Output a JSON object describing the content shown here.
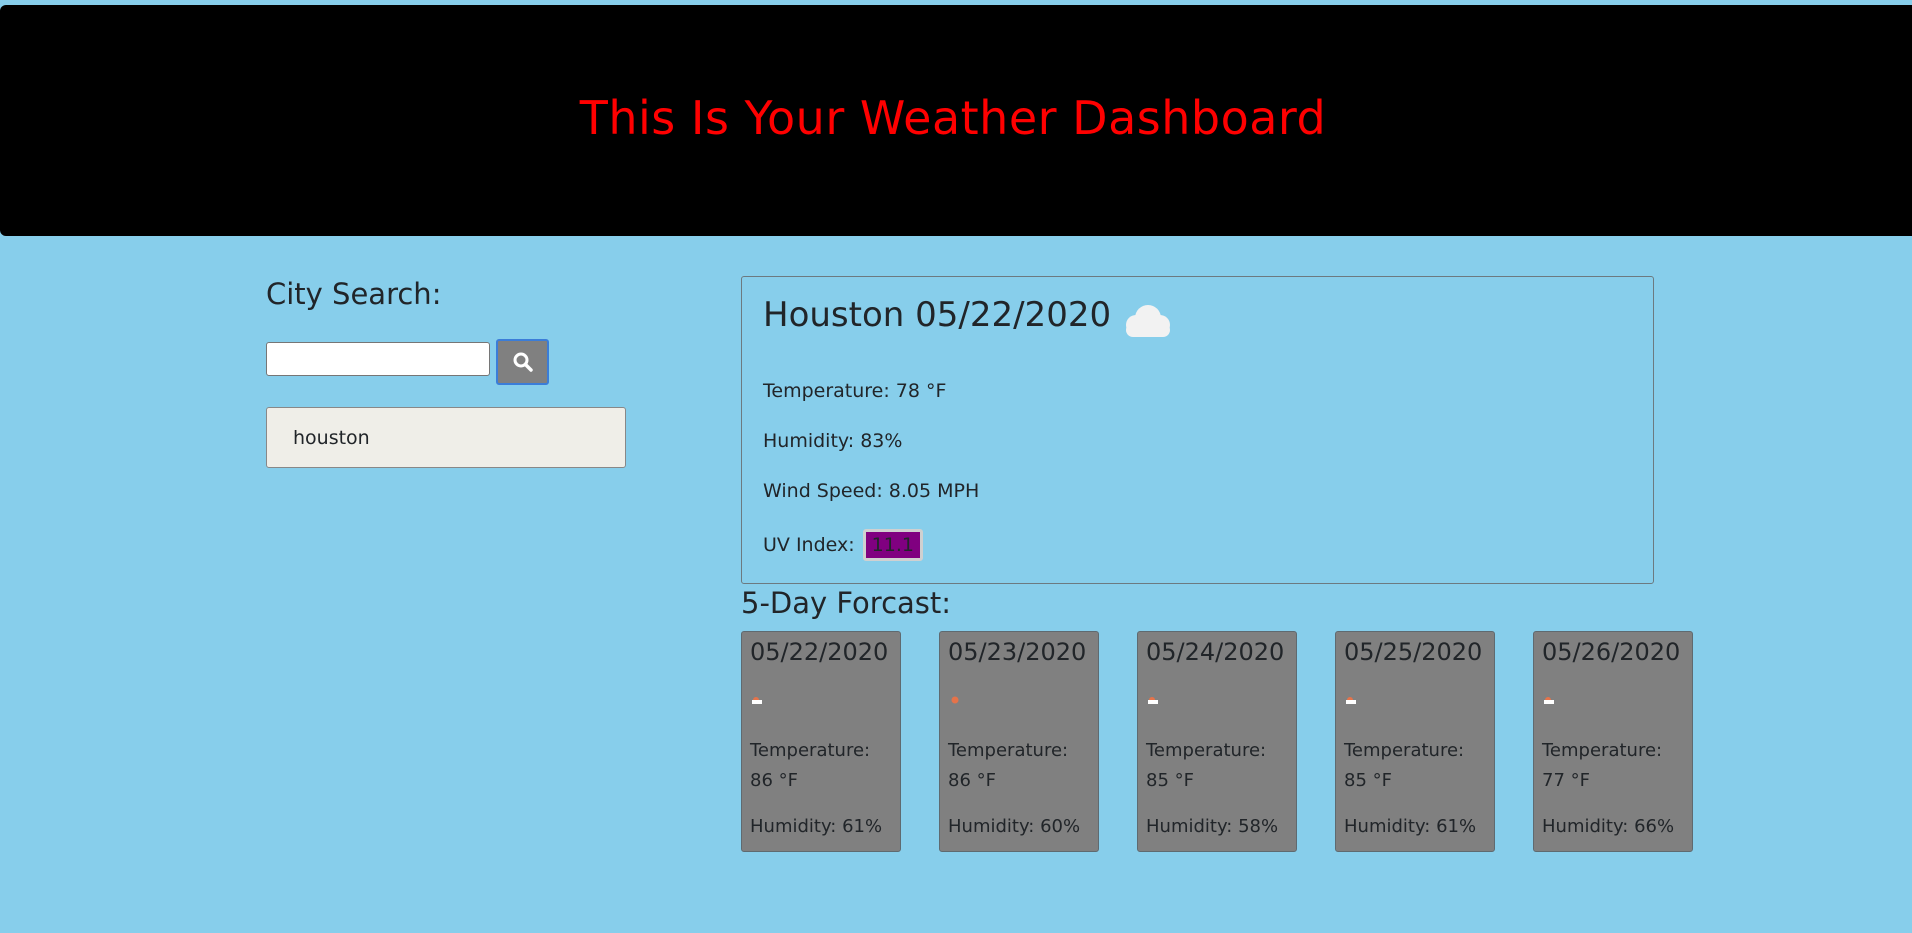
{
  "header": {
    "title": "This Is Your Weather Dashboard"
  },
  "search": {
    "title": "City Search:",
    "input_value": "",
    "button_icon": "search-icon",
    "history": [
      "houston"
    ]
  },
  "current": {
    "title": "Houston 05/22/2020",
    "icon": "cloud-icon",
    "temperature": "Temperature: 78 °F",
    "humidity": "Humidity: 83%",
    "wind": "Wind Speed: 8.05 MPH",
    "uv_label": "UV Index:",
    "uv_value": "11.1",
    "uv_color": "#800080"
  },
  "forecast": {
    "title": "5-Day Forcast:",
    "days": [
      {
        "date": "05/22/2020",
        "icon": "few-clouds-icon",
        "temp": "Temperature: 86 °F",
        "humidity": "Humidity: 61%"
      },
      {
        "date": "05/23/2020",
        "icon": "clear-sun-icon",
        "temp": "Temperature: 86 °F",
        "humidity": "Humidity: 60%"
      },
      {
        "date": "05/24/2020",
        "icon": "few-clouds-icon",
        "temp": "Temperature: 85 °F",
        "humidity": "Humidity: 58%"
      },
      {
        "date": "05/25/2020",
        "icon": "few-clouds-icon",
        "temp": "Temperature: 85 °F",
        "humidity": "Humidity: 61%"
      },
      {
        "date": "05/26/2020",
        "icon": "few-clouds-icon",
        "temp": "Temperature: 77 °F",
        "humidity": "Humidity: 66%"
      }
    ]
  },
  "colors": {
    "page_background": "#87ceeb",
    "header_background": "#000000",
    "header_text": "#ff0000",
    "forecast_card": "#808080",
    "history_item": "#efeee8"
  }
}
